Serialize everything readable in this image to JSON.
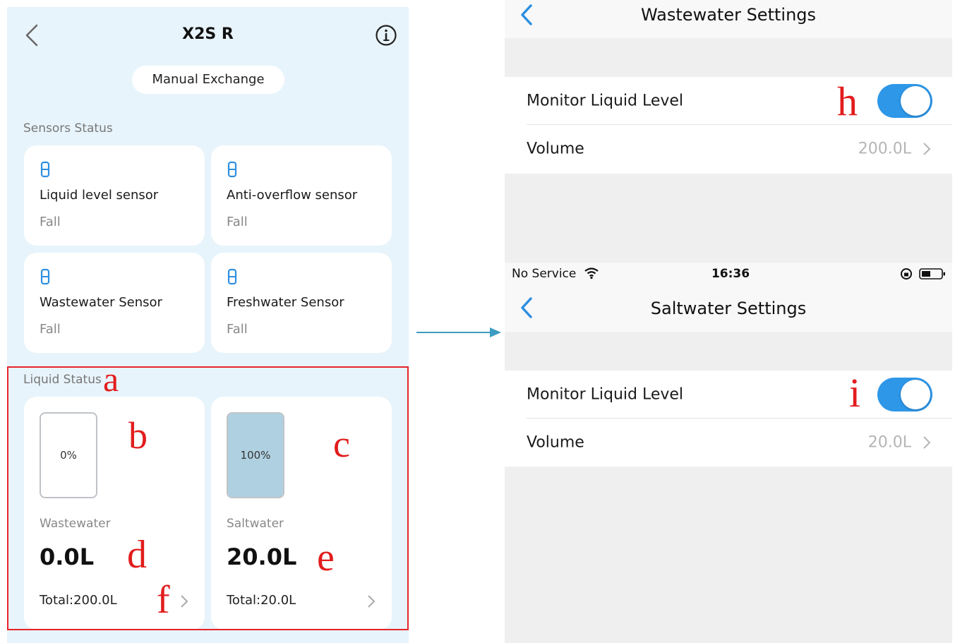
{
  "left_screen": {
    "title": "X2S R",
    "manual_exchange_label": "Manual Exchange",
    "sensors_section_label": "Sensors Status",
    "sensors": [
      {
        "name": "Liquid level sensor",
        "state": "Fall"
      },
      {
        "name": "Anti-overflow sensor",
        "state": "Fall"
      },
      {
        "name": "Wastewater Sensor",
        "state": "Fall"
      },
      {
        "name": "Freshwater Sensor",
        "state": "Fall"
      }
    ],
    "liquid_section_label": "Liquid Status",
    "tanks": [
      {
        "percent_label": "0%",
        "fill_fraction": 0,
        "name": "Wastewater",
        "value": "0.0L",
        "total": "Total:200.0L"
      },
      {
        "percent_label": "100%",
        "fill_fraction": 1,
        "name": "Saltwater",
        "value": "20.0L",
        "total": "Total:20.0L"
      }
    ]
  },
  "annotations": {
    "a": "a",
    "b": "b",
    "c": "c",
    "d": "d",
    "e": "e",
    "f": "f",
    "h": "h",
    "i": "i"
  },
  "wastewater_settings": {
    "title": "Wastewater Settings",
    "monitor_label": "Monitor Liquid Level",
    "monitor_on": true,
    "volume_label": "Volume",
    "volume_value": "200.0L"
  },
  "saltwater_settings": {
    "status_bar": {
      "carrier": "No Service",
      "time": "16:36"
    },
    "title": "Saltwater Settings",
    "monitor_label": "Monitor Liquid Level",
    "monitor_on": true,
    "volume_label": "Volume",
    "volume_value": "20.0L"
  },
  "colors": {
    "left_bg": "#e8f4fb",
    "toggle_on": "#2e97e8",
    "annotation_red": "#e21d1d",
    "tank_fill": "#afd0e0",
    "arrow": "#3d9cc2"
  }
}
